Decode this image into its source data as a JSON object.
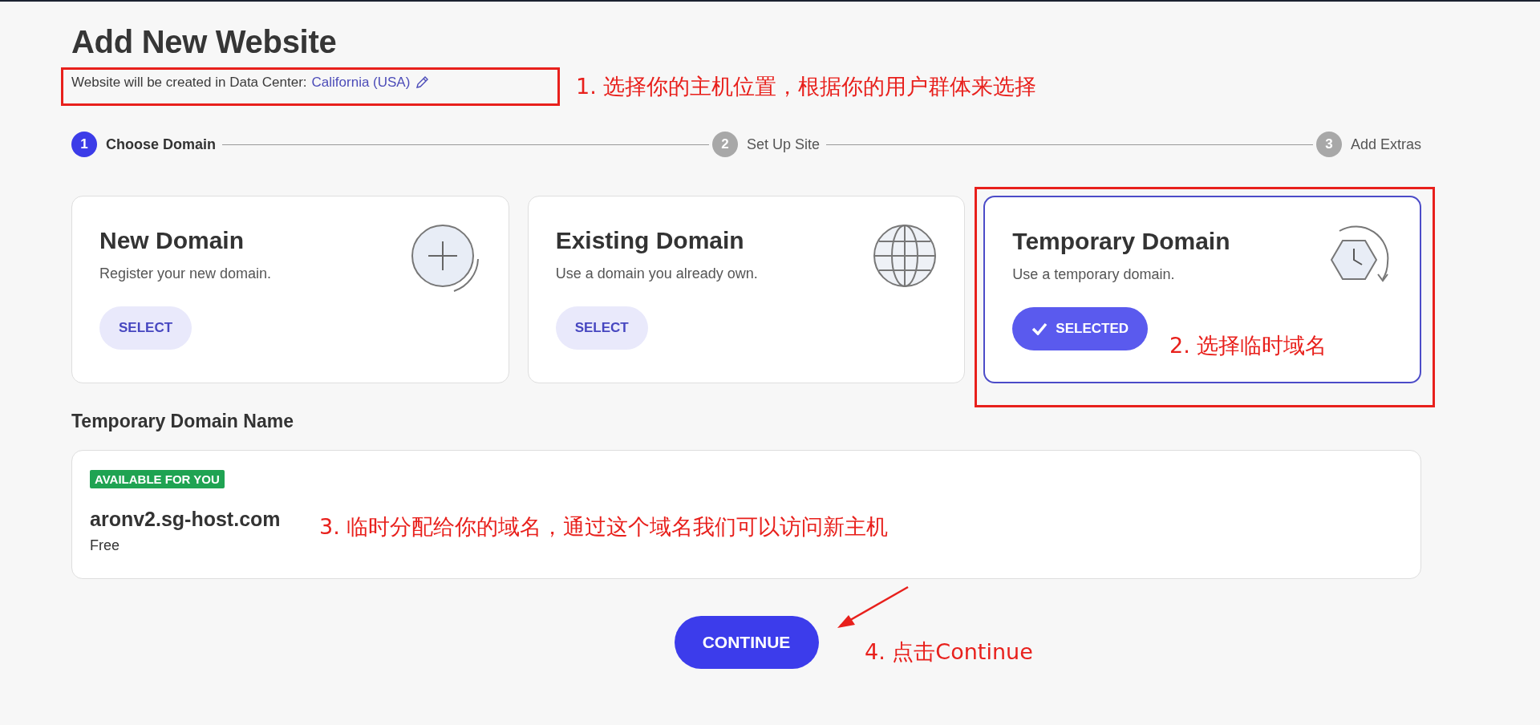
{
  "page": {
    "title": "Add New Website",
    "data_center_label": "Website will be created in Data Center:",
    "data_center_value": "California (USA)"
  },
  "steps": [
    {
      "number": "1",
      "label": "Choose Domain",
      "selected": true
    },
    {
      "number": "2",
      "label": "Set Up Site",
      "selected": false
    },
    {
      "number": "3",
      "label": "Add Extras",
      "selected": false
    }
  ],
  "options": [
    {
      "kind": "new",
      "title": "New Domain",
      "description": "Register your new domain.",
      "button": "SELECT",
      "selected": false
    },
    {
      "kind": "existing",
      "title": "Existing Domain",
      "description": "Use a domain you already own.",
      "button": "SELECT",
      "selected": false
    },
    {
      "kind": "temporary",
      "title": "Temporary Domain",
      "description": "Use a temporary domain.",
      "button": "SELECTED",
      "selected": true
    }
  ],
  "domain_name": {
    "heading": "Temporary Domain Name",
    "badge": "AVAILABLE FOR YOU",
    "domain": "aronv2.sg-host.com",
    "price": "Free"
  },
  "continue_button": "CONTINUE",
  "annotations": [
    {
      "text": "1. 选择你的主机位置，根据你的用户群体来选择"
    },
    {
      "text": "2. 选择临时域名"
    },
    {
      "text": "3. 临时分配给你的域名，通过这个域名我们可以访问新主机"
    },
    {
      "text": "4. 点击Continue"
    }
  ]
}
